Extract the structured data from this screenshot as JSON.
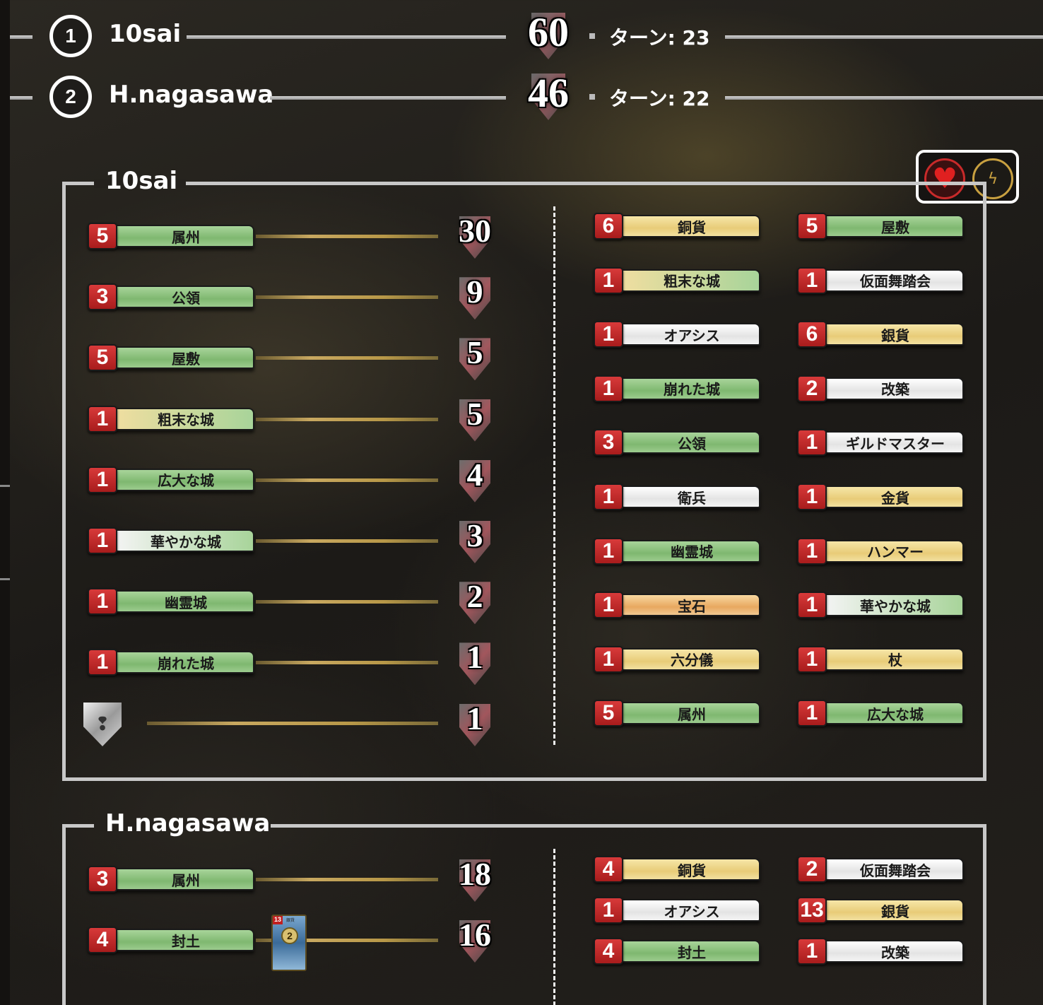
{
  "scoreboard": [
    {
      "rank": "1",
      "name": "10sai",
      "score": "60",
      "turn": "ターン: 23"
    },
    {
      "rank": "2",
      "name": "H.nagasawa",
      "score": "46",
      "turn": "ターン: 22"
    }
  ],
  "panel1": {
    "title": "10sai",
    "vp_rows": [
      {
        "count": "5",
        "label": "属州",
        "color": "green",
        "vp": "30"
      },
      {
        "count": "3",
        "label": "公領",
        "color": "green",
        "vp": "9"
      },
      {
        "count": "5",
        "label": "屋敷",
        "color": "green",
        "vp": "5"
      },
      {
        "count": "1",
        "label": "粗末な城",
        "color": "mixgy",
        "vp": "5"
      },
      {
        "count": "1",
        "label": "広大な城",
        "color": "green",
        "vp": "4"
      },
      {
        "count": "1",
        "label": "華やかな城",
        "color": "mixwg",
        "vp": "3"
      },
      {
        "count": "1",
        "label": "幽霊城",
        "color": "green",
        "vp": "2"
      },
      {
        "count": "1",
        "label": "崩れた城",
        "color": "green",
        "vp": "1"
      }
    ],
    "token_vp": "1",
    "deck_col1": [
      {
        "count": "6",
        "label": "銅貨",
        "color": "yellow"
      },
      {
        "count": "1",
        "label": "粗末な城",
        "color": "mixgy"
      },
      {
        "count": "1",
        "label": "オアシス",
        "color": "white"
      },
      {
        "count": "1",
        "label": "崩れた城",
        "color": "green"
      },
      {
        "count": "3",
        "label": "公領",
        "color": "green"
      },
      {
        "count": "1",
        "label": "衛兵",
        "color": "white"
      },
      {
        "count": "1",
        "label": "幽霊城",
        "color": "green"
      },
      {
        "count": "1",
        "label": "宝石",
        "color": "gold"
      },
      {
        "count": "1",
        "label": "六分儀",
        "color": "yellow"
      },
      {
        "count": "5",
        "label": "属州",
        "color": "green"
      }
    ],
    "deck_col2": [
      {
        "count": "5",
        "label": "屋敷",
        "color": "green"
      },
      {
        "count": "1",
        "label": "仮面舞踏会",
        "color": "white"
      },
      {
        "count": "6",
        "label": "銀貨",
        "color": "yellow"
      },
      {
        "count": "2",
        "label": "改築",
        "color": "white"
      },
      {
        "count": "1",
        "label": "ギルドマスター",
        "color": "white"
      },
      {
        "count": "1",
        "label": "金貨",
        "color": "yellow"
      },
      {
        "count": "1",
        "label": "ハンマー",
        "color": "yellow"
      },
      {
        "count": "1",
        "label": "華やかな城",
        "color": "mixwg"
      },
      {
        "count": "1",
        "label": "杖",
        "color": "yellow"
      },
      {
        "count": "1",
        "label": "広大な城",
        "color": "green"
      }
    ]
  },
  "panel2": {
    "title": "H.nagasawa",
    "vp_rows": [
      {
        "count": "3",
        "label": "属州",
        "color": "green",
        "vp": "18"
      },
      {
        "count": "4",
        "label": "封土",
        "color": "green",
        "vp": "16"
      }
    ],
    "mini_card": {
      "cost": "13",
      "name": "銀貨",
      "coin": "2"
    },
    "deck_col1": [
      {
        "count": "4",
        "label": "銅貨",
        "color": "yellow"
      },
      {
        "count": "1",
        "label": "オアシス",
        "color": "white"
      },
      {
        "count": "4",
        "label": "封土",
        "color": "green"
      }
    ],
    "deck_col2": [
      {
        "count": "2",
        "label": "仮面舞踏会",
        "color": "white"
      },
      {
        "count": "13",
        "label": "銀貨",
        "color": "yellow"
      },
      {
        "count": "1",
        "label": "改築",
        "color": "white"
      }
    ]
  },
  "icons": {
    "favorite": "heart-icon",
    "bolt": "lightning-icon"
  }
}
